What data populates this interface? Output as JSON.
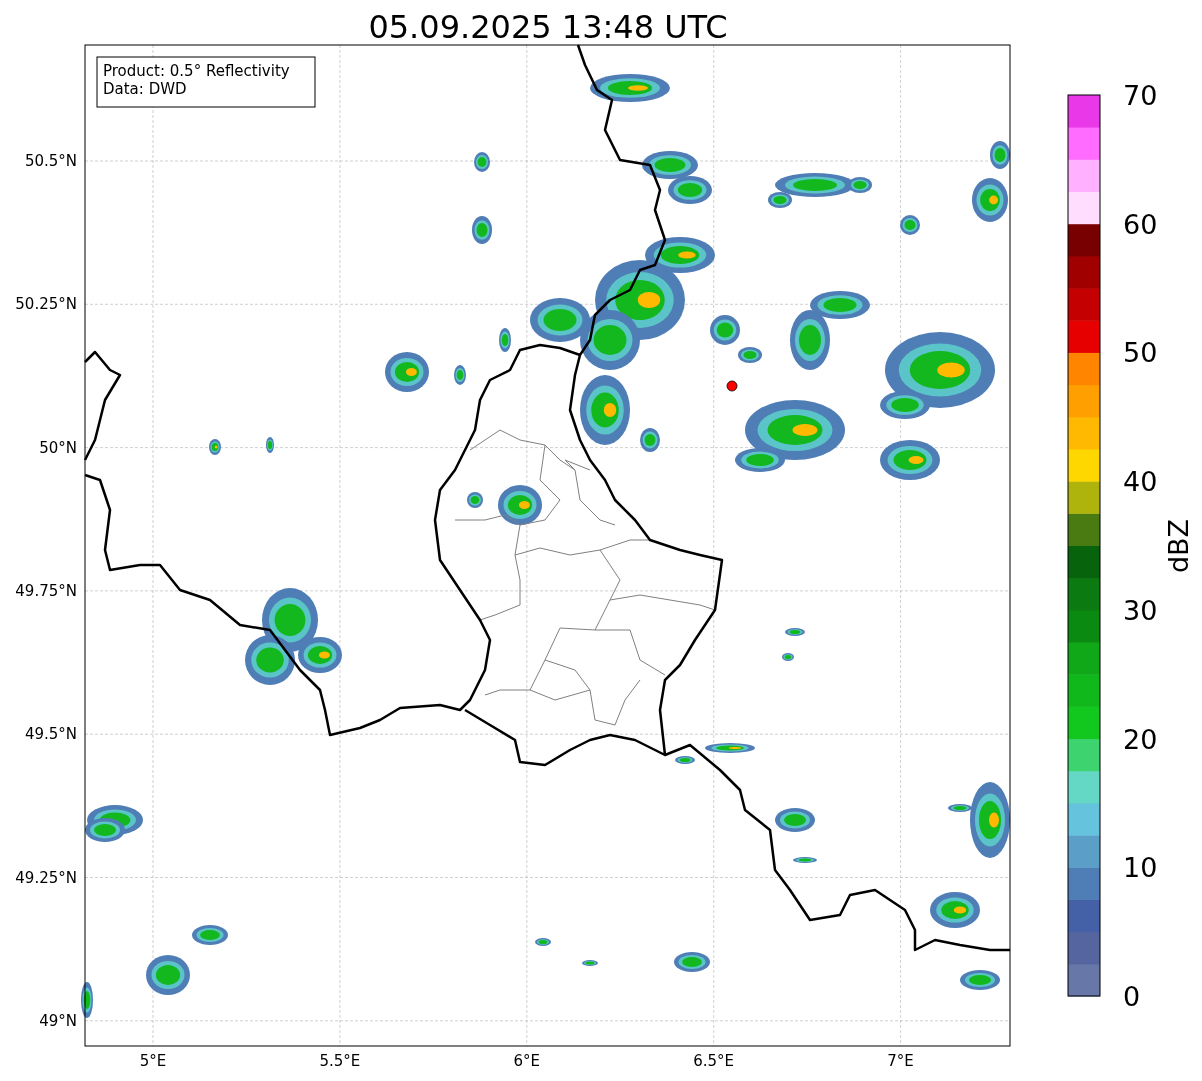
{
  "title": "05.09.2025 13:48 UTC",
  "legend": {
    "lines": [
      "Product: 0.5° Reflectivity",
      "Data: DWD"
    ]
  },
  "lat_ticks": [
    "50.5°N",
    "50.25°N",
    "50°N",
    "49.75°N",
    "49.5°N",
    "49.25°N",
    "49°N"
  ],
  "lon_ticks": [
    "5°E",
    "5.5°E",
    "6°E",
    "6.5°E",
    "7°E"
  ],
  "colorbar": {
    "label": "dBZ",
    "ticks": [
      "70",
      "60",
      "50",
      "40",
      "30",
      "20",
      "10",
      "0"
    ],
    "segments": [
      {
        "color": "#6677a8"
      },
      {
        "color": "#5565a0"
      },
      {
        "color": "#4460a6"
      },
      {
        "color": "#4f7db5"
      },
      {
        "color": "#5b9fc8"
      },
      {
        "color": "#66c3de"
      },
      {
        "color": "#64d8c4"
      },
      {
        "color": "#3dd46f"
      },
      {
        "color": "#12c81e"
      },
      {
        "color": "#10b81c"
      },
      {
        "color": "#10a818"
      },
      {
        "color": "#0b8a12"
      },
      {
        "color": "#0b7a10"
      },
      {
        "color": "#08640c"
      },
      {
        "color": "#4a7a12"
      },
      {
        "color": "#afb40c"
      },
      {
        "color": "#ffd700"
      },
      {
        "color": "#ffb900"
      },
      {
        "color": "#ff9f00"
      },
      {
        "color": "#ff8500"
      },
      {
        "color": "#e60000"
      },
      {
        "color": "#c40000"
      },
      {
        "color": "#a00000"
      },
      {
        "color": "#780000"
      },
      {
        "color": "#ffddff"
      },
      {
        "color": "#ffb0ff"
      },
      {
        "color": "#ff6cff"
      },
      {
        "color": "#e838e8"
      }
    ]
  }
}
